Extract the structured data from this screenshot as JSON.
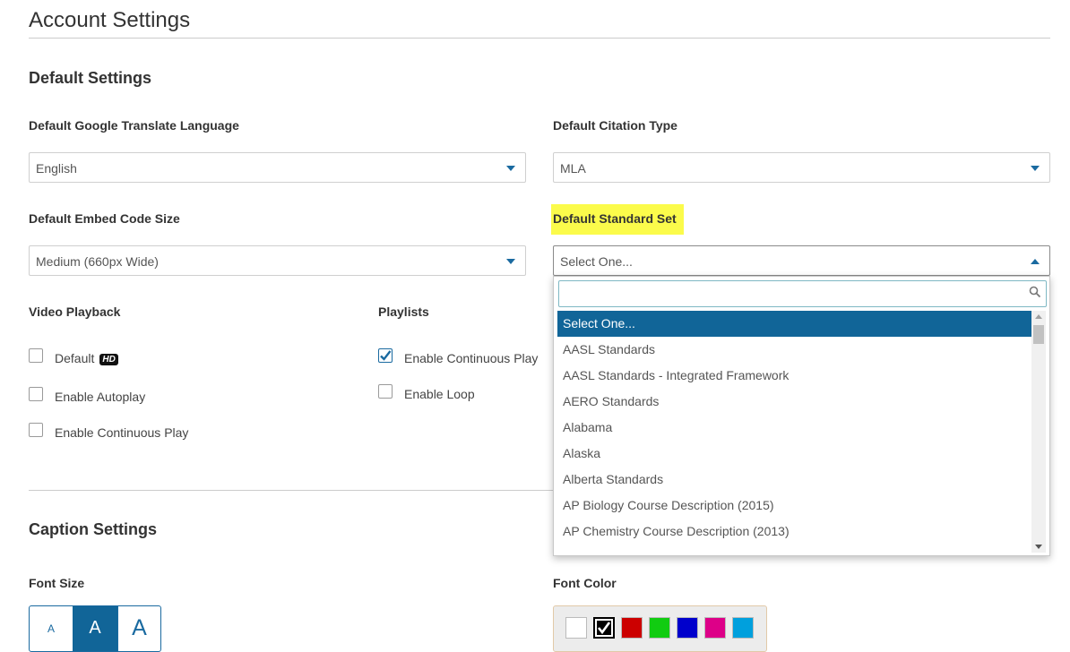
{
  "page": {
    "title": "Account Settings"
  },
  "default_settings": {
    "heading": "Default Settings",
    "translate_language": {
      "label": "Default Google Translate Language",
      "value": "English"
    },
    "citation_type": {
      "label": "Default Citation Type",
      "value": "MLA"
    },
    "embed_code_size": {
      "label": "Default Embed Code Size",
      "value": "Medium (660px Wide)"
    },
    "standard_set": {
      "label": "Default Standard Set",
      "value": "Select One...",
      "search_value": "",
      "options": [
        "Select One...",
        "AASL Standards",
        "AASL Standards - Integrated Framework",
        "AERO Standards",
        "Alabama",
        "Alaska",
        "Alberta Standards",
        "AP Biology Course Description (2015)",
        "AP Chemistry Course Description (2013)"
      ],
      "selected_index": 0,
      "highlight_color": "#fbfb4b"
    }
  },
  "video_playback": {
    "heading": "Video Playback",
    "options": [
      {
        "label": "Default",
        "badge": "HD",
        "checked": false
      },
      {
        "label": "Enable Autoplay",
        "checked": false
      },
      {
        "label": "Enable Continuous Play",
        "checked": false
      }
    ]
  },
  "playlists": {
    "heading": "Playlists",
    "options": [
      {
        "label": "Enable Continuous Play",
        "checked": true
      },
      {
        "label": "Enable Loop",
        "checked": false
      }
    ]
  },
  "caption_settings": {
    "heading": "Caption Settings",
    "font_size": {
      "label": "Font Size",
      "options": [
        "A",
        "A",
        "A"
      ],
      "selected_index": 1
    },
    "font_color": {
      "label": "Font Color",
      "swatches": [
        "#ffffff",
        "#000000",
        "#cc0000",
        "#11cc11",
        "#0000cc",
        "#dd0088",
        "#00a0dd"
      ],
      "selected_index": 1
    }
  },
  "colors": {
    "accent": "#116598",
    "caret": "#1a6aa0"
  },
  "icons": {
    "dropdown": "caret-down-icon",
    "search": "search-icon",
    "check": "checkmark-icon"
  }
}
